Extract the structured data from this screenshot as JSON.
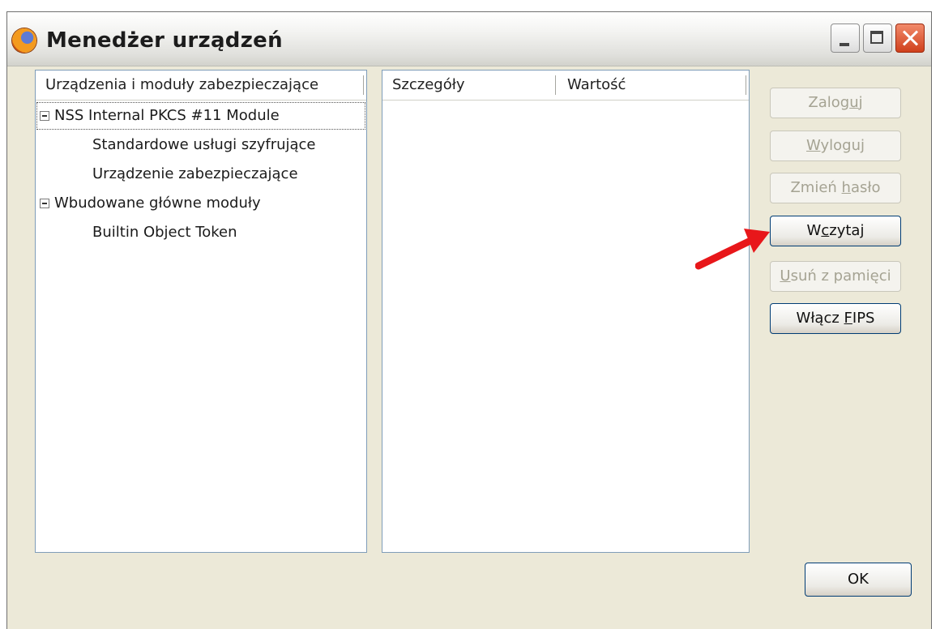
{
  "window": {
    "title": "Menedżer urządzeń"
  },
  "tree": {
    "header": "Urządzenia i moduły zabezpieczające",
    "items": [
      {
        "label": "NSS Internal PKCS #11 Module",
        "expanded": true
      },
      {
        "label": "Standardowe usługi szyfrujące"
      },
      {
        "label": "Urządzenie zabezpieczające"
      },
      {
        "label": "Wbudowane główne moduły",
        "expanded": true
      },
      {
        "label": "Builtin Object Token"
      }
    ]
  },
  "details": {
    "col1": "Szczegóły",
    "col2": "Wartość"
  },
  "buttons": {
    "login": {
      "pre": "Zalog",
      "key": "u",
      "post": "j",
      "enabled": false
    },
    "logout": {
      "pre": "",
      "key": "W",
      "post": "yloguj",
      "enabled": false
    },
    "change_password": {
      "pre": "Zmień ",
      "key": "h",
      "post": "asło",
      "enabled": false
    },
    "load": {
      "pre": "W",
      "key": "c",
      "post": "zytaj",
      "enabled": true
    },
    "unload": {
      "pre": "",
      "key": "U",
      "post": "suń z pamięci",
      "enabled": false
    },
    "fips": {
      "pre": "Włącz ",
      "key": "F",
      "post": "IPS",
      "enabled": true
    },
    "ok": "OK"
  },
  "colors": {
    "annotation_arrow": "#e8171a"
  }
}
